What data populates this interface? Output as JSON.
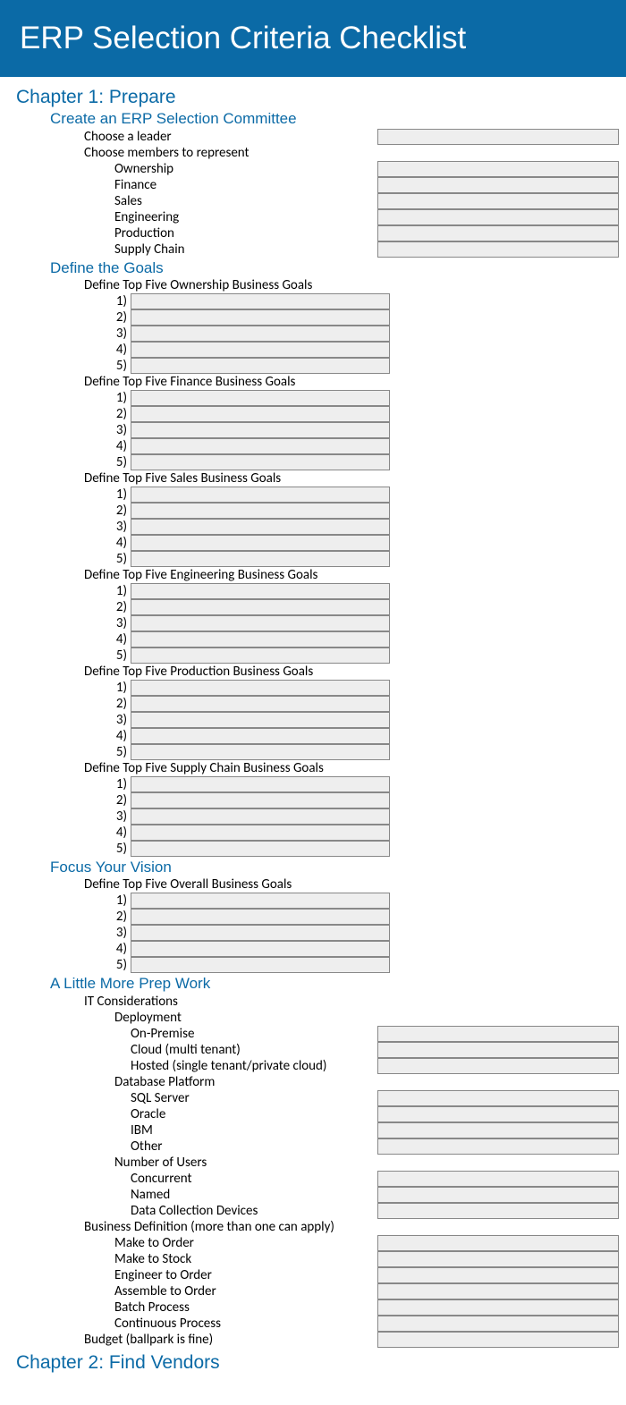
{
  "banner": "ERP Selection Criteria Checklist",
  "chapter1": "Chapter 1: Prepare",
  "chapter2": "Chapter 2: Find Vendors",
  "sec_committee": "Create an ERP Selection Committee",
  "committee_leader": "Choose a leader",
  "committee_members": "Choose members to represent",
  "members": {
    "ownership": "Ownership",
    "finance": "Finance",
    "sales": "Sales",
    "engineering": "Engineering",
    "production": "Production",
    "supply": "Supply Chain"
  },
  "sec_goals": "Define the Goals",
  "goals": {
    "ownership": "Define Top Five Ownership Business Goals",
    "finance": "Define Top Five Finance Business Goals",
    "sales": "Define Top Five Sales Business Goals",
    "engineering": "Define Top Five Engineering Business Goals",
    "production": "Define Top Five Production Business Goals",
    "supply": "Define Top Five Supply Chain Business Goals"
  },
  "nums": [
    "1)",
    "2)",
    "3)",
    "4)",
    "5)"
  ],
  "sec_vision": "Focus Your Vision",
  "vision_label": "Define Top Five Overall Business Goals",
  "sec_prep": "A Little More Prep Work",
  "prep": {
    "it": "IT Considerations",
    "deployment": "Deployment",
    "dep_onprem": "On-Premise",
    "dep_cloud": "Cloud (multi tenant)",
    "dep_hosted": "Hosted (single tenant/private cloud)",
    "db": "Database Platform",
    "db_sql": "SQL Server",
    "db_oracle": "Oracle",
    "db_ibm": "IBM",
    "db_other": "Other",
    "users": "Number of Users",
    "u_conc": "Concurrent",
    "u_named": "Named",
    "u_dcd": "Data Collection Devices",
    "bizdef": "Business Definition (more than one can apply)",
    "bd_mto": "Make to Order",
    "bd_mts": "Make to Stock",
    "bd_eto": "Engineer to Order",
    "bd_ato": "Assemble to Order",
    "bd_batch": "Batch Process",
    "bd_cont": "Continuous Process",
    "budget": "Budget (ballpark is fine)"
  }
}
